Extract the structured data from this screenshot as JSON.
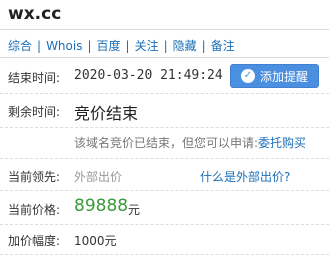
{
  "domain": "wx.cc",
  "nav": [
    {
      "label": "综合"
    },
    {
      "label": "Whois"
    },
    {
      "label": "百度"
    },
    {
      "label": "关注"
    },
    {
      "label": "隐藏"
    },
    {
      "label": "备注"
    }
  ],
  "nav_separator": "|",
  "end_time": {
    "label": "结束时间:",
    "value": "2020-03-20 21:49:24"
  },
  "reminder_button": {
    "label": "添加提醒",
    "icon": "check-circle-icon"
  },
  "remaining": {
    "label": "剩余时间:",
    "value": "竞价结束"
  },
  "notice": {
    "text": "该域名竞价已结束，但您可以申请:",
    "link": "委托购买"
  },
  "leader": {
    "label": "当前领先:",
    "value": "外部出价"
  },
  "help_link": "什么是外部出价?",
  "price": {
    "label": "当前价格:",
    "value": "89888",
    "unit": "元"
  },
  "increment": {
    "label": "加价幅度:",
    "value": "1000元"
  },
  "colors": {
    "link": "#1a6fb9",
    "button": "#4a8fe0",
    "price": "#3a9a3a"
  }
}
